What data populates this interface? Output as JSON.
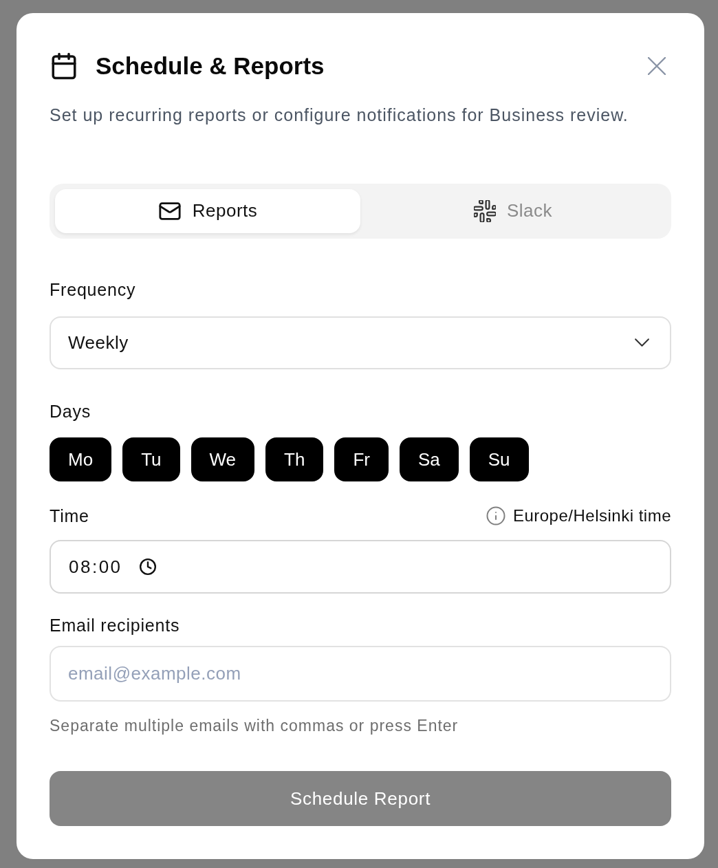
{
  "dialog": {
    "title": "Schedule & Reports",
    "description": "Set up recurring reports or configure notifications for Business review."
  },
  "tabs": [
    {
      "label": "Reports",
      "selected": true,
      "kind": "email"
    },
    {
      "label": "Slack",
      "selected": false,
      "kind": "chat"
    }
  ],
  "frequency": {
    "label": "Frequency",
    "value": "Weekly"
  },
  "days": {
    "label": "Days",
    "options": [
      {
        "label": "Mo",
        "selected": true
      },
      {
        "label": "Tu",
        "selected": true
      },
      {
        "label": "We",
        "selected": true
      },
      {
        "label": "Th",
        "selected": true
      },
      {
        "label": "Fr",
        "selected": true
      },
      {
        "label": "Sa",
        "selected": true
      },
      {
        "label": "Su",
        "selected": true
      }
    ]
  },
  "time": {
    "label": "Time",
    "timezone": "Europe/Helsinki time",
    "value": "08:00"
  },
  "email": {
    "label": "Email recipients",
    "placeholder": "email@example.com",
    "hint": "Separate multiple emails with commas or press Enter"
  },
  "submit": {
    "label": "Schedule Report",
    "disabled": true
  }
}
